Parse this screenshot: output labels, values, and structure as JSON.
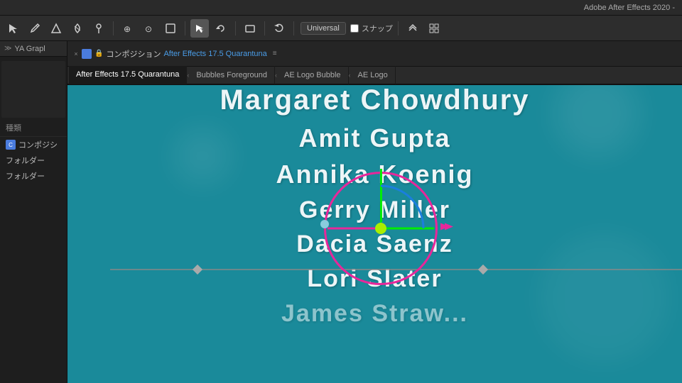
{
  "titlebar": {
    "text": "Adobe After Effects 2020 -"
  },
  "toolbar": {
    "tools": [
      {
        "id": "selection",
        "label": "▲",
        "active": false
      },
      {
        "id": "pen",
        "label": "✒",
        "active": false
      },
      {
        "id": "shape",
        "label": "◆",
        "active": false
      },
      {
        "id": "roto",
        "label": "✂",
        "active": false
      },
      {
        "id": "pin",
        "label": "📌",
        "active": false
      },
      {
        "id": "separator1",
        "type": "separator"
      },
      {
        "id": "pan",
        "label": "⊕",
        "active": false
      },
      {
        "id": "orbit",
        "label": "⊙",
        "active": false
      },
      {
        "id": "zoom-rect",
        "label": "▢",
        "active": false
      },
      {
        "id": "separator2",
        "type": "separator"
      },
      {
        "id": "move",
        "label": "↖",
        "active": true
      },
      {
        "id": "rotate",
        "label": "↻",
        "active": false
      },
      {
        "id": "separator3",
        "type": "separator"
      },
      {
        "id": "rect-select",
        "label": "⬜",
        "active": false
      },
      {
        "id": "separator4",
        "type": "separator"
      },
      {
        "id": "undo",
        "label": "↩",
        "active": false
      }
    ],
    "universal_label": "Universal",
    "snap_label": "スナップ",
    "snap_checked": false
  },
  "left_panel": {
    "title": "YA Grapl",
    "items": [
      {
        "label": "種類",
        "type": "category"
      },
      {
        "label": "コンポジシ",
        "type": "item",
        "icon": "comp"
      },
      {
        "label": "フォルダー",
        "type": "item"
      },
      {
        "label": "フォルダー",
        "type": "item"
      }
    ]
  },
  "tab_bar": {
    "close_icon": "×",
    "comp_title": "コンポジション",
    "comp_subtitle": "After Effects 17.5 Quarantuna",
    "menu_icon": "≡",
    "lock_icon": "🔒"
  },
  "tabs": [
    {
      "label": "After Effects 17.5 Quarantuna",
      "active": true
    },
    {
      "label": "Bubbles Foreground",
      "active": false
    },
    {
      "label": "AE Logo Bubble",
      "active": false
    },
    {
      "label": "AE Logo",
      "active": false
    }
  ],
  "viewport": {
    "background_color": "#1a8a9a",
    "names": [
      {
        "text": "Margaret Chowdhury",
        "size": "large",
        "position": "top"
      },
      {
        "text": "Amit Gupta",
        "size": "medium",
        "position": "upper-mid"
      },
      {
        "text": "Annika Koenig",
        "size": "medium",
        "position": "mid"
      },
      {
        "text": "Gerry Miller",
        "size": "medium",
        "position": "lower-mid"
      },
      {
        "text": "Dacia Saenz",
        "size": "medium",
        "position": "bottom-1"
      },
      {
        "text": "Lori Slater",
        "size": "medium",
        "position": "bottom-2"
      },
      {
        "text": "James Straw...",
        "size": "medium",
        "position": "bottom-3"
      }
    ],
    "gizmo": {
      "rotation_circle_color": "#e8279a",
      "y_axis_color": "#00ff00",
      "x_axis_color": "#00ff00",
      "x_negative_color": "#e8279a",
      "blue_arc_color": "#1a7fdd",
      "center_dot_color": "#aaee00",
      "anchor_dot_color": "#e8279a",
      "left_handle_color": "#88ccdd"
    },
    "motion_path": {
      "line_color": "#888888",
      "keyframe_color": "#aaaaaa"
    }
  }
}
